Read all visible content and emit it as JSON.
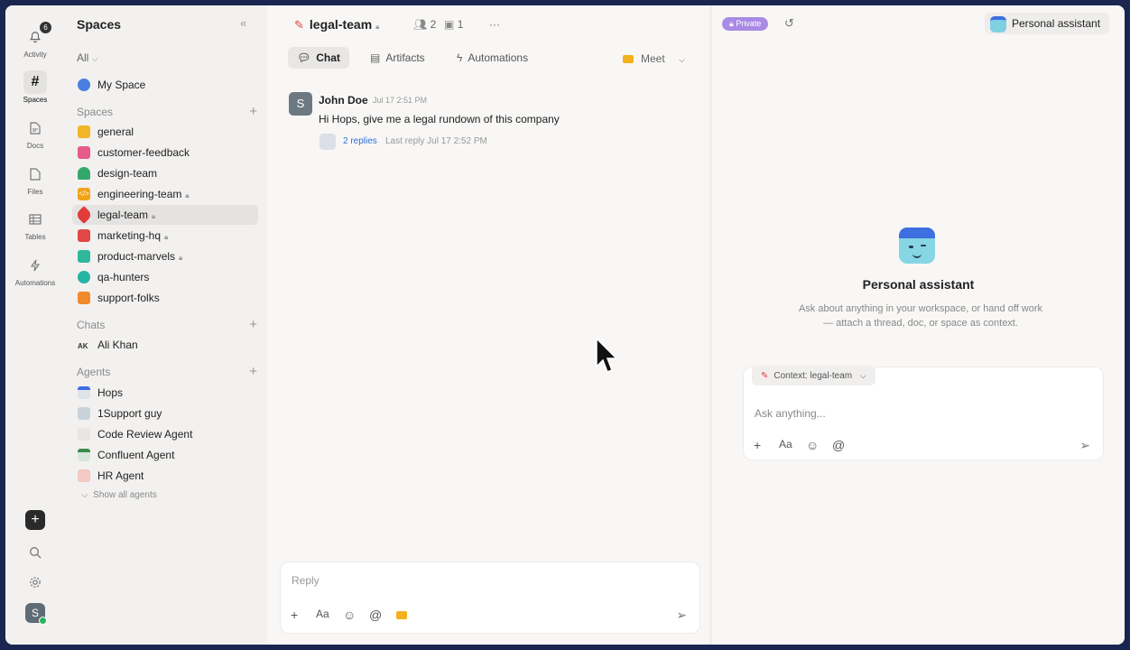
{
  "rail": {
    "items": [
      {
        "label": "Activity",
        "badge": "6"
      },
      {
        "label": "Spaces"
      },
      {
        "label": "Docs"
      },
      {
        "label": "Files"
      },
      {
        "label": "Tables"
      },
      {
        "label": "Automations"
      }
    ],
    "avatar": "S"
  },
  "sidebar": {
    "title": "Spaces",
    "filter": "All",
    "my_space": "My Space",
    "spaces_header": "Spaces",
    "spaces": [
      {
        "name": "general",
        "color": "#f0b627"
      },
      {
        "name": "customer-feedback",
        "color": "#e85a8a"
      },
      {
        "name": "design-team",
        "color": "#34a86b"
      },
      {
        "name": "engineering-team",
        "color": "#f0a419"
      },
      {
        "name": "legal-team",
        "color": "#e23b3b"
      },
      {
        "name": "marketing-hq",
        "color": "#e24848"
      },
      {
        "name": "product-marvels",
        "color": "#2fb89c"
      },
      {
        "name": "qa-hunters",
        "color": "#25b3a4"
      },
      {
        "name": "support-folks",
        "color": "#f08a2c"
      }
    ],
    "chats_header": "Chats",
    "chats": [
      {
        "initials": "AK",
        "name": "Ali Khan"
      }
    ],
    "agents_header": "Agents",
    "agents": [
      {
        "name": "Hops"
      },
      {
        "name": "1Support guy"
      },
      {
        "name": "Code Review Agent"
      },
      {
        "name": "Confluent Agent"
      },
      {
        "name": "HR Agent"
      }
    ],
    "show_all": "Show all agents"
  },
  "main": {
    "title": "legal-team",
    "members": "2",
    "files": "1",
    "more": "···",
    "tabs": [
      {
        "label": "Chat"
      },
      {
        "label": "Artifacts"
      },
      {
        "label": "Automations"
      }
    ],
    "meet": "Meet",
    "message": {
      "avatar": "S",
      "author": "John Doe",
      "time": "Jul 17 2:51 PM",
      "text": "Hi Hops, give me a legal rundown of this company",
      "replies": "2 replies",
      "last_reply": "Last reply Jul 17 2:52 PM"
    },
    "composer": {
      "placeholder": "Reply"
    }
  },
  "right": {
    "private": "Private",
    "assistant_button": "Personal assistant",
    "title": "Personal assistant",
    "description": "Ask about anything in your workspace, or hand off work — attach a thread, doc, or space as context.",
    "context": "Context: legal-team",
    "placeholder": "Ask anything..."
  }
}
